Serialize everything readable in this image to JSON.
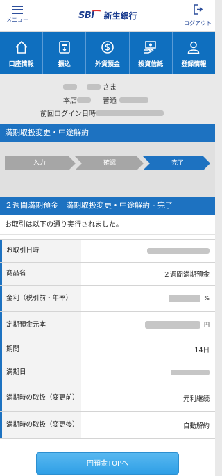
{
  "header": {
    "menu_label": "メニュー",
    "logout_label": "ログアウト",
    "brand_sbi": "SBI",
    "brand_name": "新生銀行"
  },
  "nav": {
    "items": [
      {
        "label": "口座情報",
        "icon": "home-icon"
      },
      {
        "label": "振込",
        "icon": "transfer-icon"
      },
      {
        "label": "外貨預金",
        "icon": "currency-icon"
      },
      {
        "label": "投資信託",
        "icon": "investment-icon"
      },
      {
        "label": "登録情報",
        "icon": "user-icon"
      }
    ]
  },
  "user": {
    "honorific": "さま",
    "branch_label": "本店",
    "account_type": "普通",
    "last_login_label": "前回ログイン日時"
  },
  "section_title": "満期取扱変更・中途解約",
  "steps": [
    {
      "label": "入力",
      "state": "done"
    },
    {
      "label": "確認",
      "state": "done"
    },
    {
      "label": "完了",
      "state": "current"
    }
  ],
  "result": {
    "title": "２週間満期預金　満期取扱変更・中途解約 - 完了",
    "message": "お取引は以下の通り実行されました。"
  },
  "details": {
    "transaction_datetime": {
      "label": "お取引日時"
    },
    "product_name": {
      "label": "商品名",
      "value": "２週間満期預金"
    },
    "interest_rate": {
      "label": "金利（税引前・年率）",
      "unit": "%"
    },
    "principal": {
      "label": "定期預金元本",
      "unit": "円"
    },
    "period": {
      "label": "期間",
      "value": "14日"
    },
    "maturity_date": {
      "label": "満期日"
    },
    "maturity_handling_before": {
      "label": "満期時の取扱（変更前）",
      "value": "元利継続"
    },
    "maturity_handling_after": {
      "label": "満期時の取扱（変更後）",
      "value": "自動解約"
    }
  },
  "footer": {
    "yen_top_button": "円預金TOPへ"
  },
  "colors": {
    "brand_blue": "#0f6fbf",
    "section_blue": "#1d72c1",
    "step_done": "#a6a6a6",
    "step_current": "#1d72c1",
    "button_blue": "#3aa8ea"
  }
}
